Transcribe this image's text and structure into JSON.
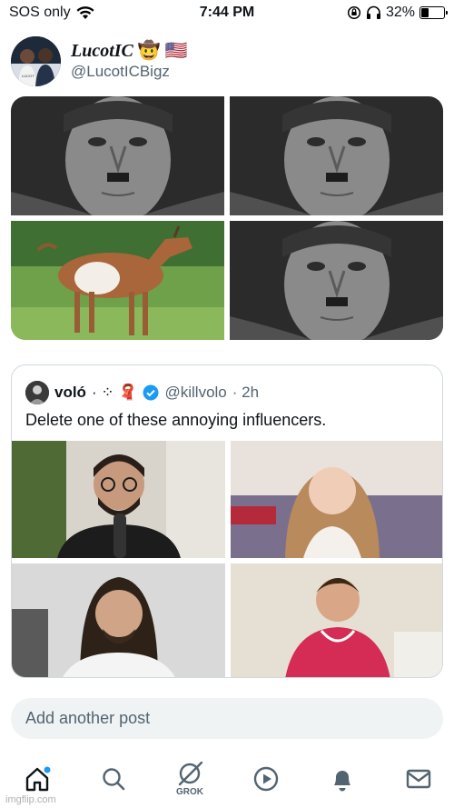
{
  "status_bar": {
    "carrier": "SOS only",
    "time": "7:44 PM",
    "battery": "32%",
    "battery_level": 0.32
  },
  "author": {
    "display_name": "LucotIC",
    "emoji": "🤠 🇺🇸",
    "handle": "@LucotICBigz"
  },
  "media": [
    {
      "icon": "portrait-photo"
    },
    {
      "icon": "portrait-photo"
    },
    {
      "icon": "goat-photo"
    },
    {
      "icon": "portrait-photo"
    }
  ],
  "quote": {
    "name": "voló",
    "name_suffix": "· ⁘ 🧣",
    "handle": "@killvolo",
    "time": "· 2h",
    "text": "Delete one of these annoying influencers.",
    "media": [
      {
        "icon": "influencer-photo"
      },
      {
        "icon": "influencer-photo"
      },
      {
        "icon": "influencer-photo"
      },
      {
        "icon": "influencer-photo"
      }
    ]
  },
  "compose": {
    "placeholder": "Add another post"
  },
  "tabbar": {
    "grok_label": "GROK"
  },
  "watermark": "imgflip.com",
  "colors": {
    "accent": "#1d9bf0",
    "muted": "#536471",
    "border": "#cfd9de",
    "compose_bg": "#eff3f4"
  }
}
